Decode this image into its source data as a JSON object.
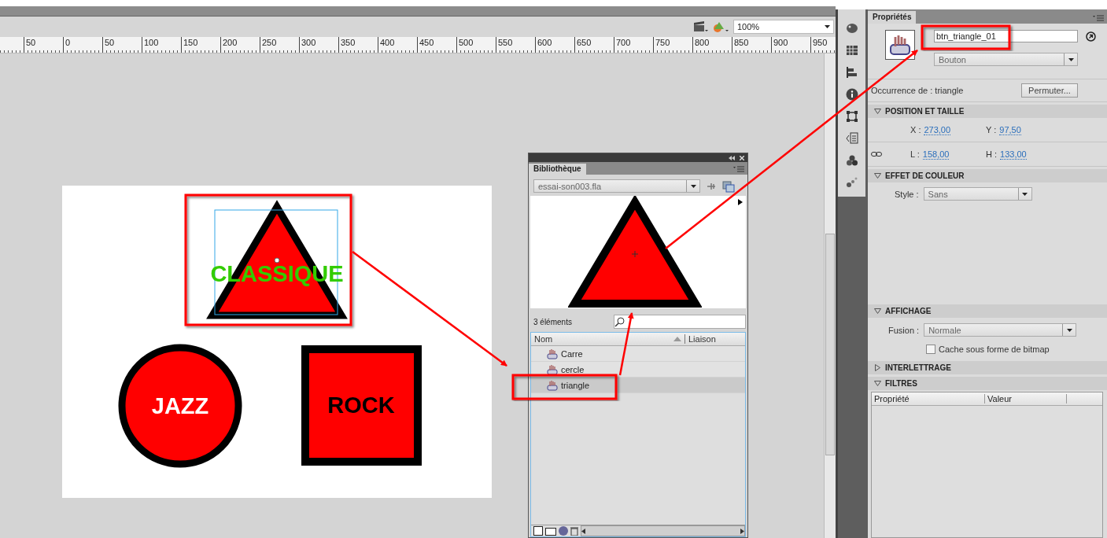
{
  "toolbar": {
    "zoom": "100%"
  },
  "ruler": {
    "labels": [
      "50",
      "0",
      "50",
      "100",
      "150",
      "200",
      "250",
      "300",
      "350",
      "400",
      "450",
      "500",
      "550",
      "600",
      "650",
      "700",
      "750",
      "800",
      "850",
      "900",
      "950"
    ]
  },
  "stage": {
    "buttons": [
      {
        "kind": "triangle",
        "label": "CLASSIQUE",
        "color": "#33cc00",
        "selected": true
      },
      {
        "kind": "circle",
        "label": "JAZZ",
        "color": "#ffffff",
        "selected": false
      },
      {
        "kind": "square",
        "label": "ROCK",
        "color": "#000000",
        "selected": false
      }
    ]
  },
  "library": {
    "tab": "Bibliothèque",
    "file": "essai-son003.fla",
    "count": "3 éléments",
    "columns": [
      "Nom",
      "Liaison"
    ],
    "items": [
      {
        "name": "Carre",
        "selected": false
      },
      {
        "name": "cercle",
        "selected": false
      },
      {
        "name": "triangle",
        "selected": true
      }
    ]
  },
  "properties": {
    "tab": "Propriétés",
    "instance_name": "btn_triangle_01",
    "type": "Bouton",
    "occurrence_label": "Occurrence de :",
    "occurrence": "triangle",
    "swap_button": "Permuter...",
    "sections": [
      {
        "kind": "position",
        "title": "POSITION ET TAILLE",
        "expanded": true,
        "rows": [
          {
            "chained": false,
            "fields": [
              {
                "label": "X :",
                "value": "273,00"
              },
              {
                "label": "Y :",
                "value": "97,50"
              }
            ]
          },
          {
            "chained": true,
            "fields": [
              {
                "label": "L :",
                "value": "158,00"
              },
              {
                "label": "H :",
                "value": "133,00"
              }
            ]
          }
        ]
      },
      {
        "kind": "color",
        "title": "EFFET DE COULEUR",
        "expanded": true,
        "label": "Style :",
        "value": "Sans"
      },
      {
        "kind": "display",
        "title": "AFFICHAGE",
        "expanded": true,
        "label": "Fusion :",
        "value": "Normale",
        "checkbox": {
          "label": "Cache sous forme de bitmap",
          "checked": false
        }
      },
      {
        "kind": "spacing",
        "title": "INTERLETTRAGE",
        "expanded": false
      },
      {
        "kind": "filters",
        "title": "FILTRES",
        "expanded": true,
        "columns": [
          "Propriété",
          "Valeur"
        ]
      }
    ]
  }
}
